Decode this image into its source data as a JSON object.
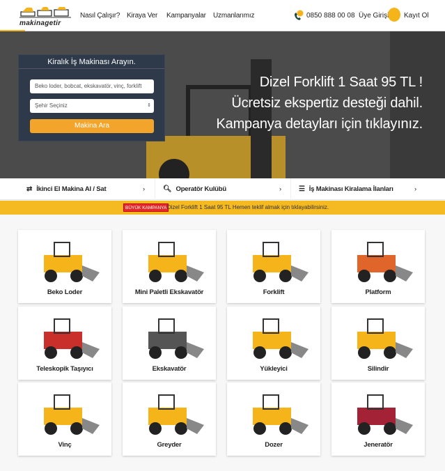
{
  "header": {
    "logo_text": "makinagetir",
    "nav": [
      "Nasıl Çalışır?",
      "Kiraya Ver",
      "Kampanyalar",
      "Uzmanlarımız"
    ],
    "phone": "0850 888 00 08",
    "login": "Üye Girişi",
    "register": "Kayıt Ol"
  },
  "hero": {
    "lines": [
      "Dizel Forklift 1 Saat 95 TL !",
      "Ücretsiz ekspertiz desteği dahil.",
      "Kampanya detayları için tıklayınız."
    ]
  },
  "search": {
    "title": "Kiralık İş Makinası Arayın.",
    "placeholder": "Beko loder, bobcat, ekskavatör, vinç, forklift vs..",
    "city": "Şehir Seçiniz",
    "button": "Makina Ara"
  },
  "links": [
    {
      "icon": "swap-icon",
      "label": "İkinci El Makina Al / Sat"
    },
    {
      "icon": "search-icon",
      "label": "Operatör Kulübü"
    },
    {
      "icon": "list-icon",
      "label": "İş Makinası Kiralama İlanları"
    }
  ],
  "campaign": {
    "badge": "BÜYÜK KAMPANYA",
    "text": "Dizel Forklift 1 Saat 95 TL Hemen teklif almak için tıklayabilirsiniz.",
    "color": "#f5b921"
  },
  "machines": [
    "Beko Loder",
    "Mini Paletli Ekskavatör",
    "Forklift",
    "Platform",
    "Teleskopik Taşıyıcı",
    "Ekskavatör",
    "Yükleyici",
    "Silindir",
    "Vinç",
    "Greyder",
    "Dozer",
    "Jeneratör"
  ]
}
